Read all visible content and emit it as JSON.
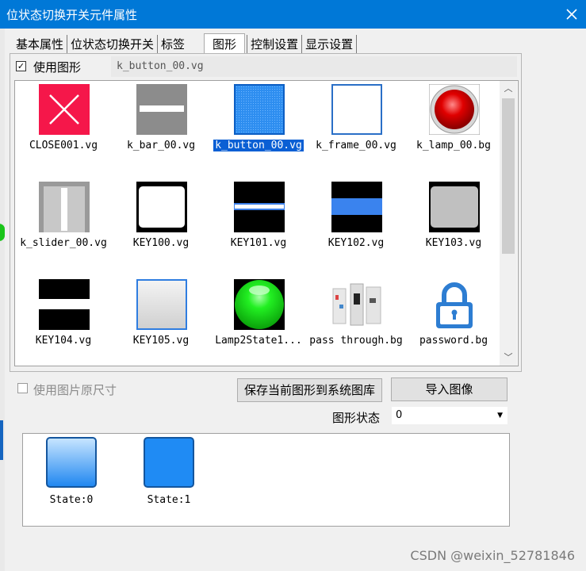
{
  "window": {
    "title": "位状态切换开关元件属性"
  },
  "tabs": [
    {
      "label": "基本属性"
    },
    {
      "label": "位状态切换开关"
    },
    {
      "label": "标签"
    },
    {
      "label": "图形",
      "active": true
    },
    {
      "label": "控制设置"
    },
    {
      "label": "显示设置"
    }
  ],
  "use_graphic": {
    "label": "使用图形",
    "checked": true,
    "filename": "k_button_00.vg"
  },
  "gallery": {
    "items": [
      {
        "name": "CLOSE001.vg",
        "icon": "close-x-icon"
      },
      {
        "name": "k_bar_00.vg",
        "icon": "bar-icon"
      },
      {
        "name": "k_button_00.vg",
        "icon": "button-icon",
        "selected": true
      },
      {
        "name": "k_frame_00.vg",
        "icon": "frame-icon"
      },
      {
        "name": "k_lamp_00.bg",
        "icon": "red-lamp-icon"
      },
      {
        "name": "k_slider_00.vg",
        "icon": "slider-icon"
      },
      {
        "name": "KEY100.vg",
        "icon": "key100-icon"
      },
      {
        "name": "KEY101.vg",
        "icon": "key101-icon"
      },
      {
        "name": "KEY102.vg",
        "icon": "key102-icon"
      },
      {
        "name": "KEY103.vg",
        "icon": "key103-icon"
      },
      {
        "name": "KEY104.vg",
        "icon": "key104-icon"
      },
      {
        "name": "KEY105.vg",
        "icon": "key105-icon"
      },
      {
        "name": "Lamp2State1...",
        "icon": "green-lamp-icon"
      },
      {
        "name": "pass through.bg",
        "icon": "pass-through-icon"
      },
      {
        "name": "password.bg",
        "icon": "lock-icon"
      }
    ]
  },
  "original_size": {
    "label": "使用图片原尺寸",
    "checked": false,
    "enabled": false
  },
  "buttons": {
    "save_to_library": "保存当前图形到系统图库",
    "import_image": "导入图像"
  },
  "graphic_state": {
    "label": "图形状态",
    "value": "0"
  },
  "states": [
    {
      "label": "State:0",
      "icon": "state0-button-icon"
    },
    {
      "label": "State:1",
      "icon": "state1-button-icon"
    }
  ],
  "watermark": "CSDN @weixin_52781846"
}
